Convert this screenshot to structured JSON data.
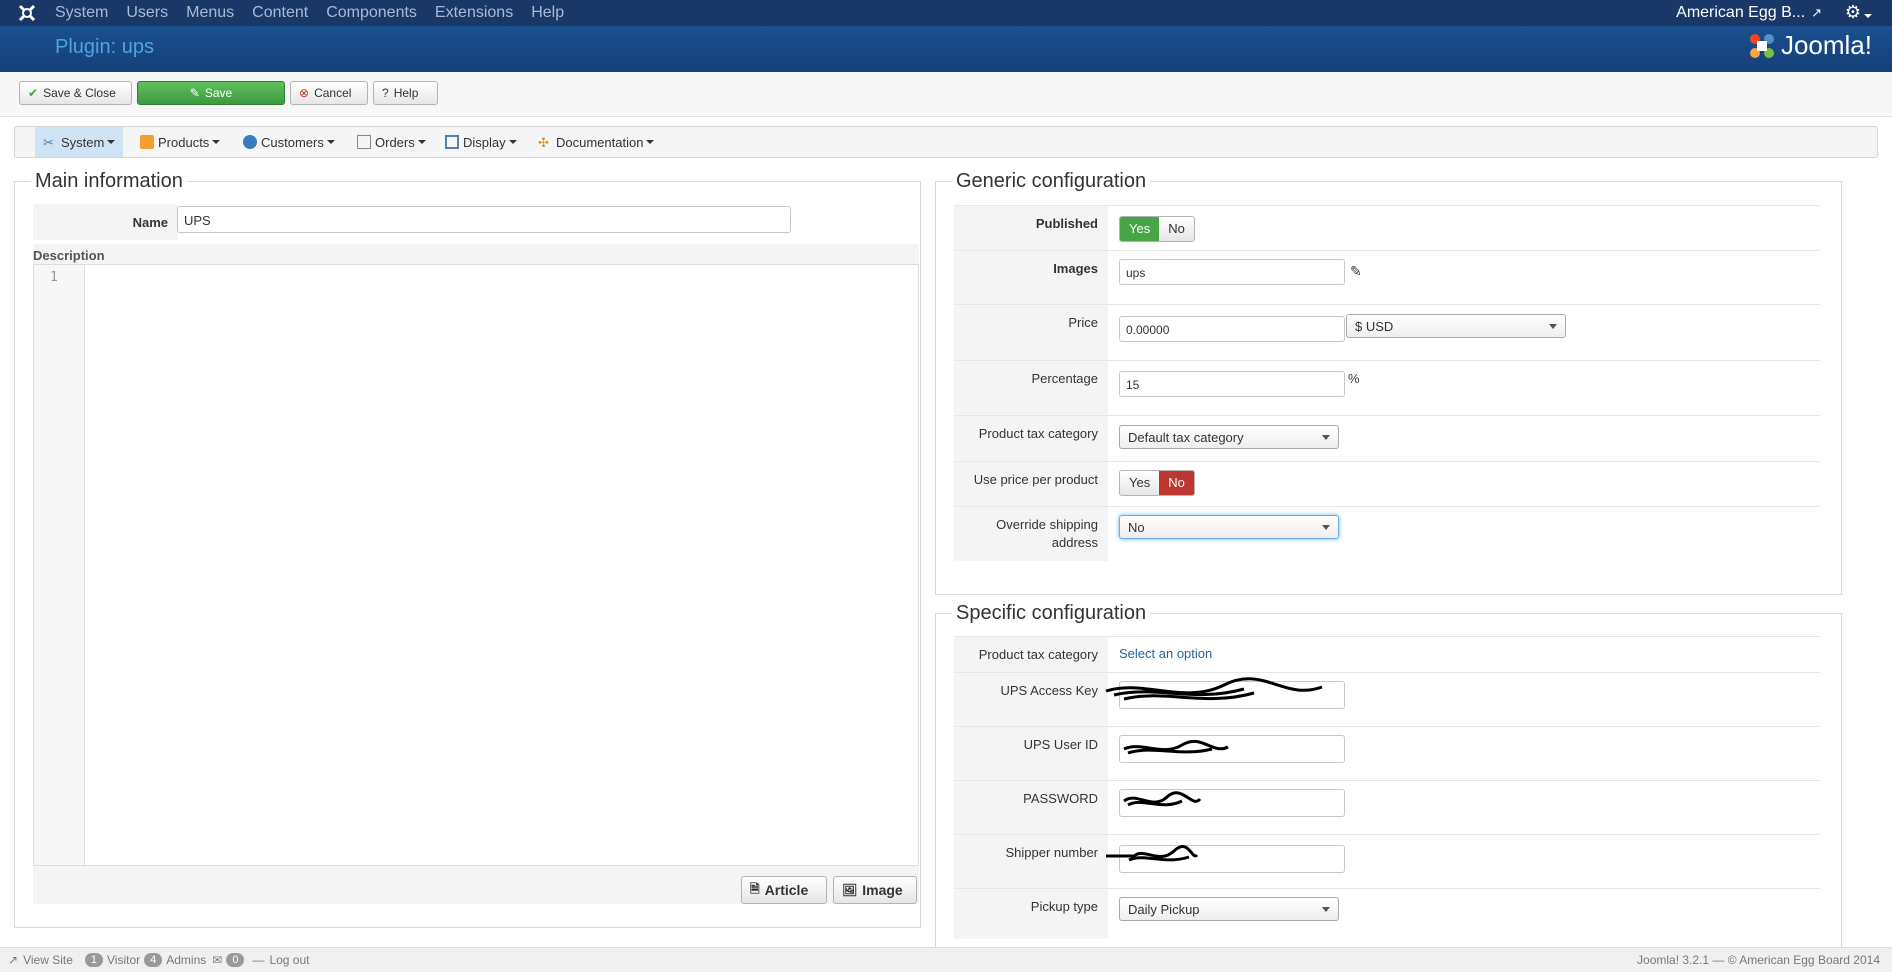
{
  "topmenu": {
    "items": [
      "System",
      "Users",
      "Menus",
      "Content",
      "Components",
      "Extensions",
      "Help"
    ],
    "site": "American Egg B..."
  },
  "header": {
    "title": "Plugin: ups",
    "brand": "Joomla!"
  },
  "toolbar": {
    "save_close": "Save & Close",
    "save": "Save",
    "cancel": "Cancel",
    "help": "Help"
  },
  "tabs": [
    "System",
    "Products",
    "Customers",
    "Orders",
    "Display",
    "Documentation"
  ],
  "main": {
    "legend": "Main information",
    "name_label": "Name",
    "name_value": "UPS",
    "description_label": "Description",
    "line_number": "1",
    "article_button": "Article",
    "image_button": "Image"
  },
  "generic": {
    "legend": "Generic configuration",
    "published_label": "Published",
    "yes": "Yes",
    "no": "No",
    "images_label": "Images",
    "images_value": "ups",
    "price_label": "Price",
    "price_value": "0.00000",
    "currency": "$ USD",
    "percentage_label": "Percentage",
    "percentage_value": "15",
    "percent_sign": "%",
    "tax_label": "Product tax category",
    "tax_value": "Default tax category",
    "price_per_product_label": "Use price per product",
    "override_label": "Override shipping address",
    "override_value": "No"
  },
  "specific": {
    "legend": "Specific configuration",
    "tax_label": "Product tax category",
    "tax_link": "Select an option",
    "access_key_label": "UPS Access Key",
    "user_id_label": "UPS User ID",
    "password_label": "PASSWORD",
    "shipper_label": "Shipper number",
    "pickup_label": "Pickup type",
    "pickup_value": "Daily Pickup"
  },
  "footer": {
    "view_site": "View Site",
    "visitors_count": "1",
    "visitor": "Visitor",
    "admins_count": "4",
    "admins": "Admins",
    "messages_count": "0",
    "logout": "Log out",
    "version": "Joomla! 3.2.1 — © American Egg Board 2014"
  },
  "colors": {
    "topnav": "#1a3867",
    "header": "#16407a",
    "save_green": "#46a546",
    "no_red": "#bd362f",
    "link": "#2a6496"
  }
}
